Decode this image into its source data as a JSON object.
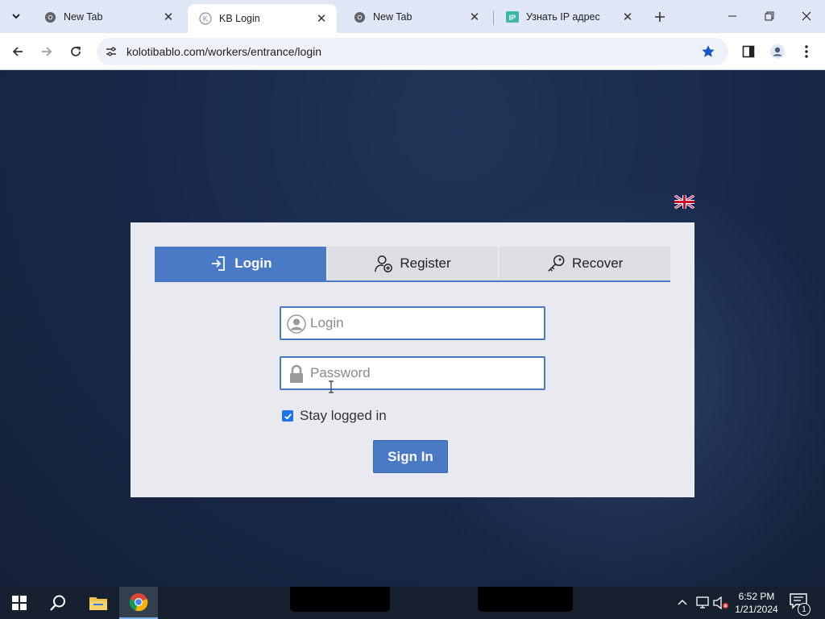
{
  "browser": {
    "tabs": [
      {
        "title": "New Tab",
        "favicon": "chrome-icon",
        "active": false
      },
      {
        "title": "KB Login",
        "favicon": "kb-icon",
        "active": true
      },
      {
        "title": "New Tab",
        "favicon": "chrome-icon",
        "active": false
      },
      {
        "title": "Узнать IP адрес",
        "favicon": "ip-icon",
        "favicon_text": "IP",
        "active": false
      }
    ],
    "url": "kolotibablo.com/workers/entrance/login",
    "bookmark_star_color": "#1a56c9"
  },
  "page": {
    "language_flag": "uk-flag-icon",
    "tabs": [
      {
        "label": "Login",
        "icon": "login-icon",
        "active": true
      },
      {
        "label": "Register",
        "icon": "add-user-icon",
        "active": false
      },
      {
        "label": "Recover",
        "icon": "key-icon",
        "active": false
      }
    ],
    "login_field": {
      "placeholder": "Login",
      "value": ""
    },
    "password_field": {
      "placeholder": "Password",
      "value": ""
    },
    "stay_logged_in": {
      "label": "Stay logged in",
      "checked": true
    },
    "signin_label": "Sign In",
    "accent_color": "#4a79c6"
  },
  "taskbar": {
    "apps": [
      "windows-start-icon",
      "search-icon",
      "file-explorer-icon",
      "chrome-icon"
    ],
    "active_app": "chrome-icon",
    "clock": {
      "time": "6:52 PM",
      "date": "1/21/2024"
    },
    "notification_count": "1"
  }
}
